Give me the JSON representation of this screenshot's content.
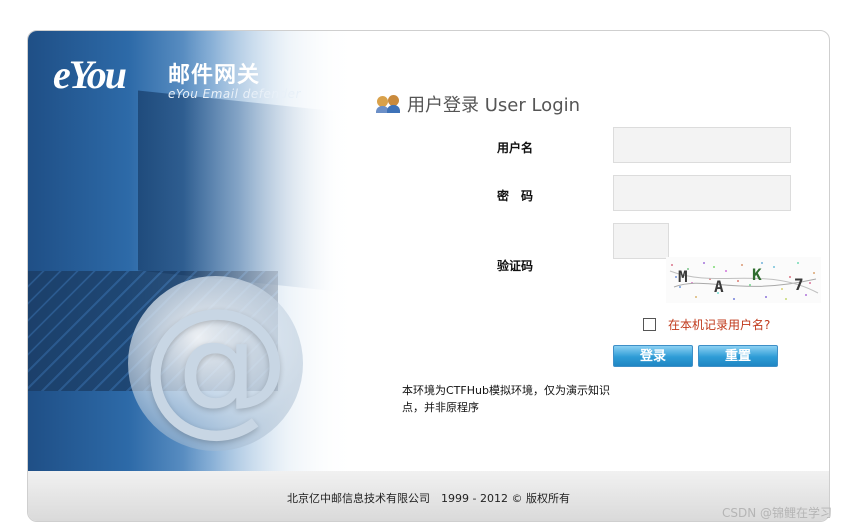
{
  "brand": {
    "logo_text": "eYou",
    "name_cn": "邮件网关",
    "name_en": "eYou Email defender"
  },
  "login": {
    "title": "用户登录 User Login",
    "username_label": "用户名",
    "password_label": "密　码",
    "captcha_label": "验证码",
    "username_value": "",
    "password_value": "",
    "captcha_value": "",
    "captcha_chars": [
      "M",
      "A",
      "K",
      "7"
    ],
    "remember_label": "在本机记录用户名?",
    "remember_checked": false,
    "login_button": "登录",
    "reset_button": "重置",
    "note": "本环境为CTFHub模拟环境，仅为演示知识点，并非原程序"
  },
  "footer": {
    "copyright": "北京亿中邮信息技术有限公司　1999 - 2012 © 版权所有"
  },
  "watermark": "CSDN @锦鲤在学习",
  "colors": {
    "accent": "#2e9cd6",
    "remember_text": "#c0391b"
  }
}
